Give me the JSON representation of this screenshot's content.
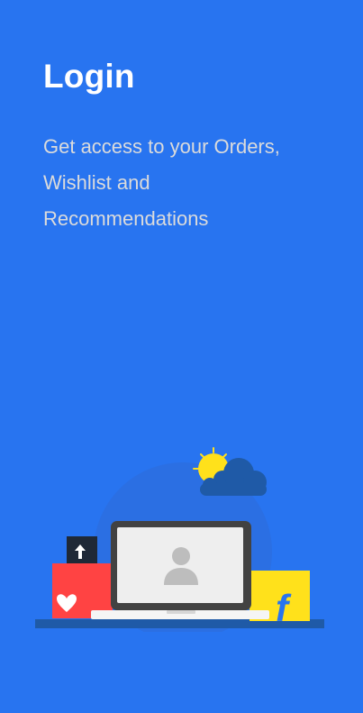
{
  "login_panel": {
    "title": "Login",
    "subtitle": "Get access to your Orders, Wishlist and Recommendations"
  },
  "colors": {
    "background": "#2874f0",
    "title": "#ffffff",
    "subtitle": "#dbdbdb",
    "accent_yellow": "#ffe11b",
    "accent_red": "#ff4343",
    "dark_blue": "#1f5aa7"
  },
  "icons": {
    "sun": "sun-icon",
    "cloud": "cloud-icon",
    "laptop": "laptop-icon",
    "profile": "user-avatar-icon",
    "heart": "heart-icon",
    "upload": "upload-arrow-icon",
    "brand": "flipkart-f-icon"
  }
}
